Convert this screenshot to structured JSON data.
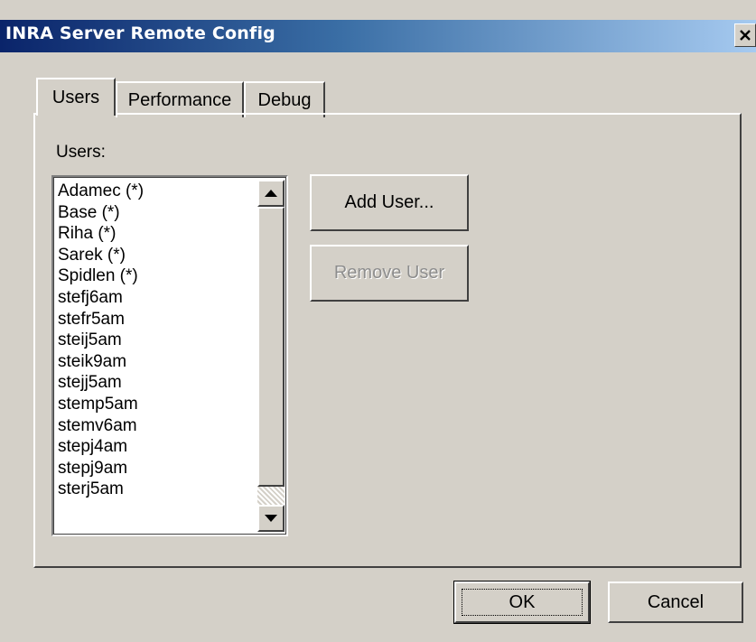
{
  "window": {
    "title": "INRA Server Remote Config"
  },
  "tabs": [
    {
      "label": "Users",
      "active": true
    },
    {
      "label": "Performance",
      "active": false
    },
    {
      "label": "Debug",
      "active": false
    }
  ],
  "users_panel": {
    "label": "Users:",
    "users": [
      "Adamec (*)",
      "Base (*)",
      "Riha (*)",
      "Sarek (*)",
      "Spidlen (*)",
      "stefj6am",
      "stefr5am",
      "steij5am",
      "steik9am",
      "stejj5am",
      "stemp5am",
      "stemv6am",
      "stepj4am",
      "stepj9am",
      "sterj5am"
    ],
    "add_user_label": "Add User...",
    "remove_user_label": "Remove User",
    "remove_user_enabled": false
  },
  "footer": {
    "ok_label": "OK",
    "cancel_label": "Cancel"
  },
  "icons": {
    "close": "close-icon",
    "scroll_up": "arrow-up-icon",
    "scroll_down": "arrow-down-icon"
  },
  "colors": {
    "face": "#d4d0c8",
    "title_start": "#0a246a",
    "title_end": "#a6caf0",
    "disabled_text": "#8d8d8d"
  }
}
